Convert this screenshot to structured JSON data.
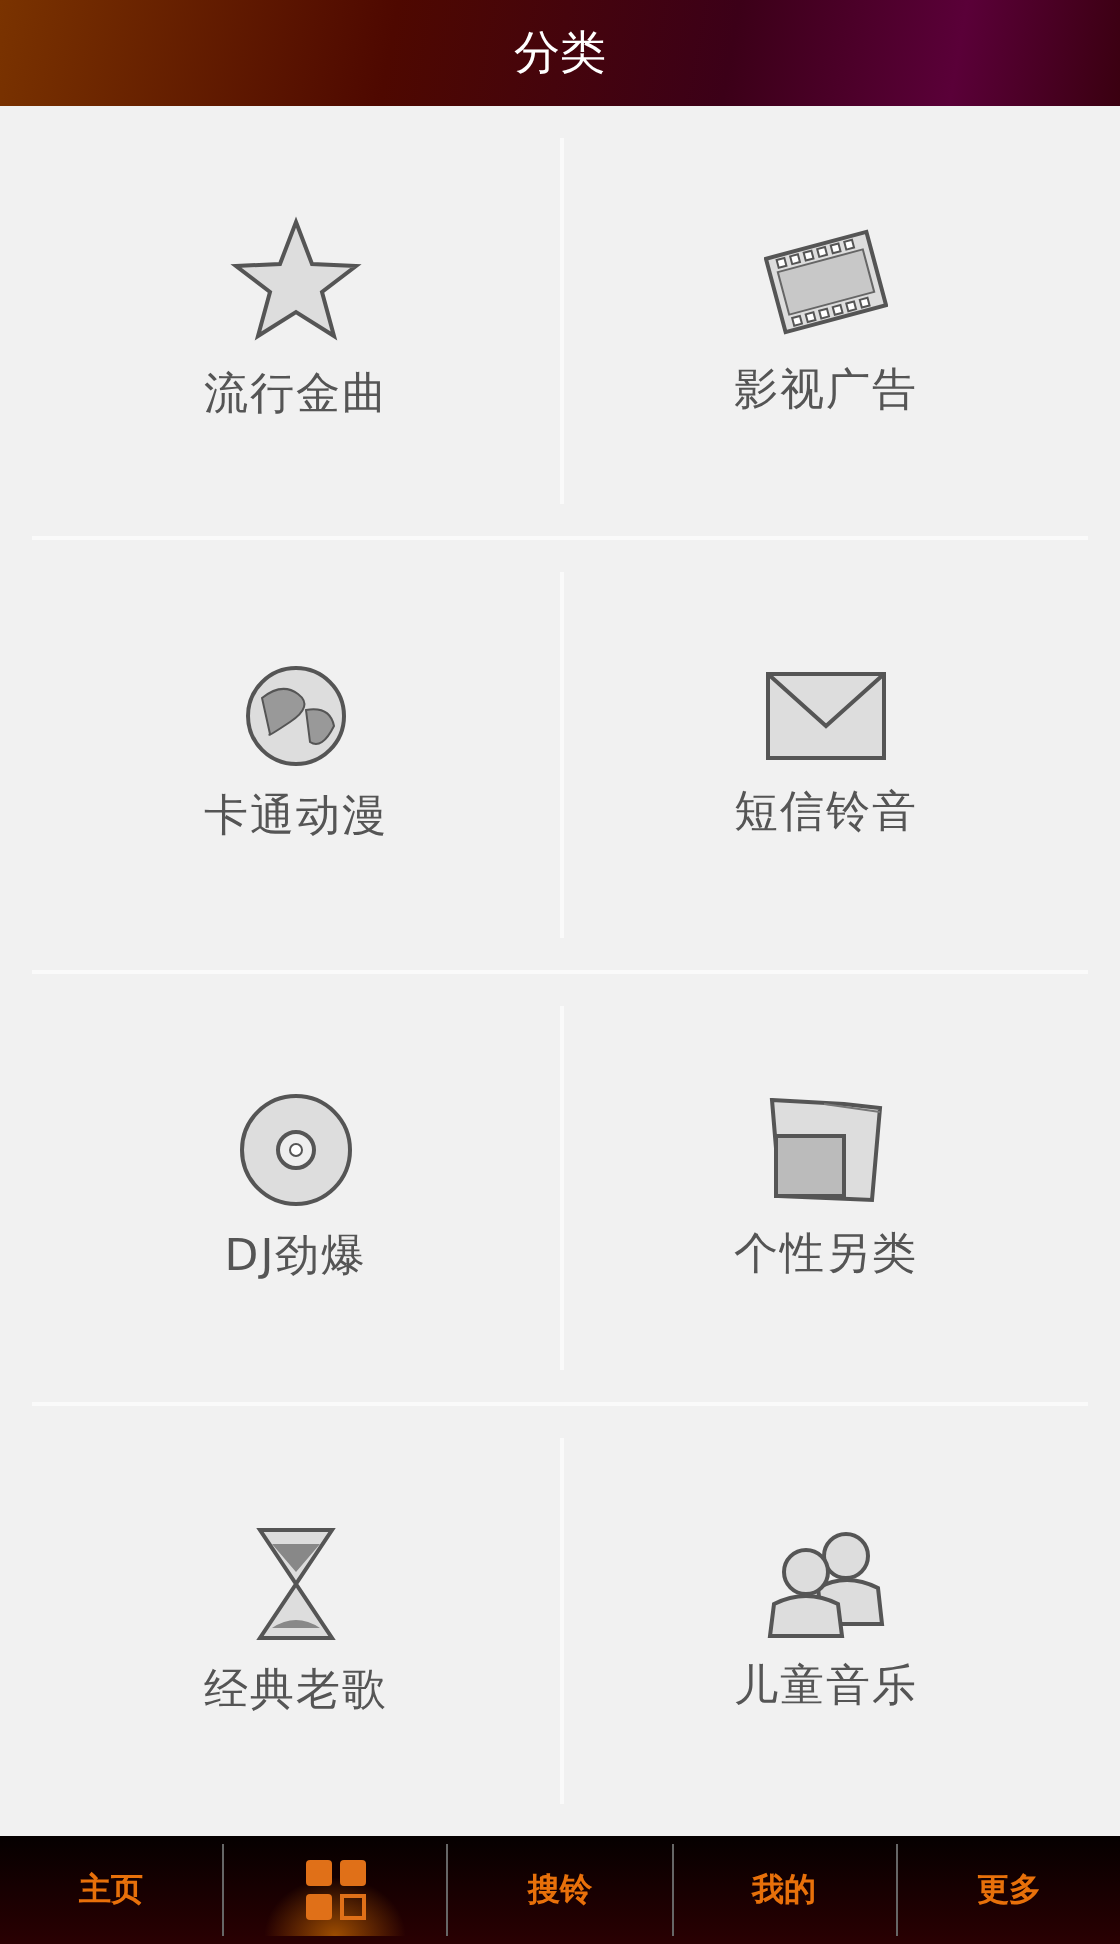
{
  "header": {
    "title": "分类"
  },
  "categories": [
    {
      "label": "流行金曲",
      "kind": "star"
    },
    {
      "label": "影视广告",
      "kind": "film"
    },
    {
      "label": "卡通动漫",
      "kind": "globe"
    },
    {
      "label": "短信铃音",
      "kind": "envelope"
    },
    {
      "label": "DJ劲爆",
      "kind": "disc"
    },
    {
      "label": "个性另类",
      "kind": "folder"
    },
    {
      "label": "经典老歌",
      "kind": "hourglass"
    },
    {
      "label": "儿童音乐",
      "kind": "people"
    }
  ],
  "tabs": [
    {
      "kind": "text",
      "label": "主页",
      "selected": false
    },
    {
      "kind": "grid",
      "selected": true
    },
    {
      "kind": "text",
      "label": "搜铃",
      "selected": false
    },
    {
      "kind": "text",
      "label": "我的",
      "selected": false
    },
    {
      "kind": "text",
      "label": "更多",
      "selected": false
    }
  ]
}
